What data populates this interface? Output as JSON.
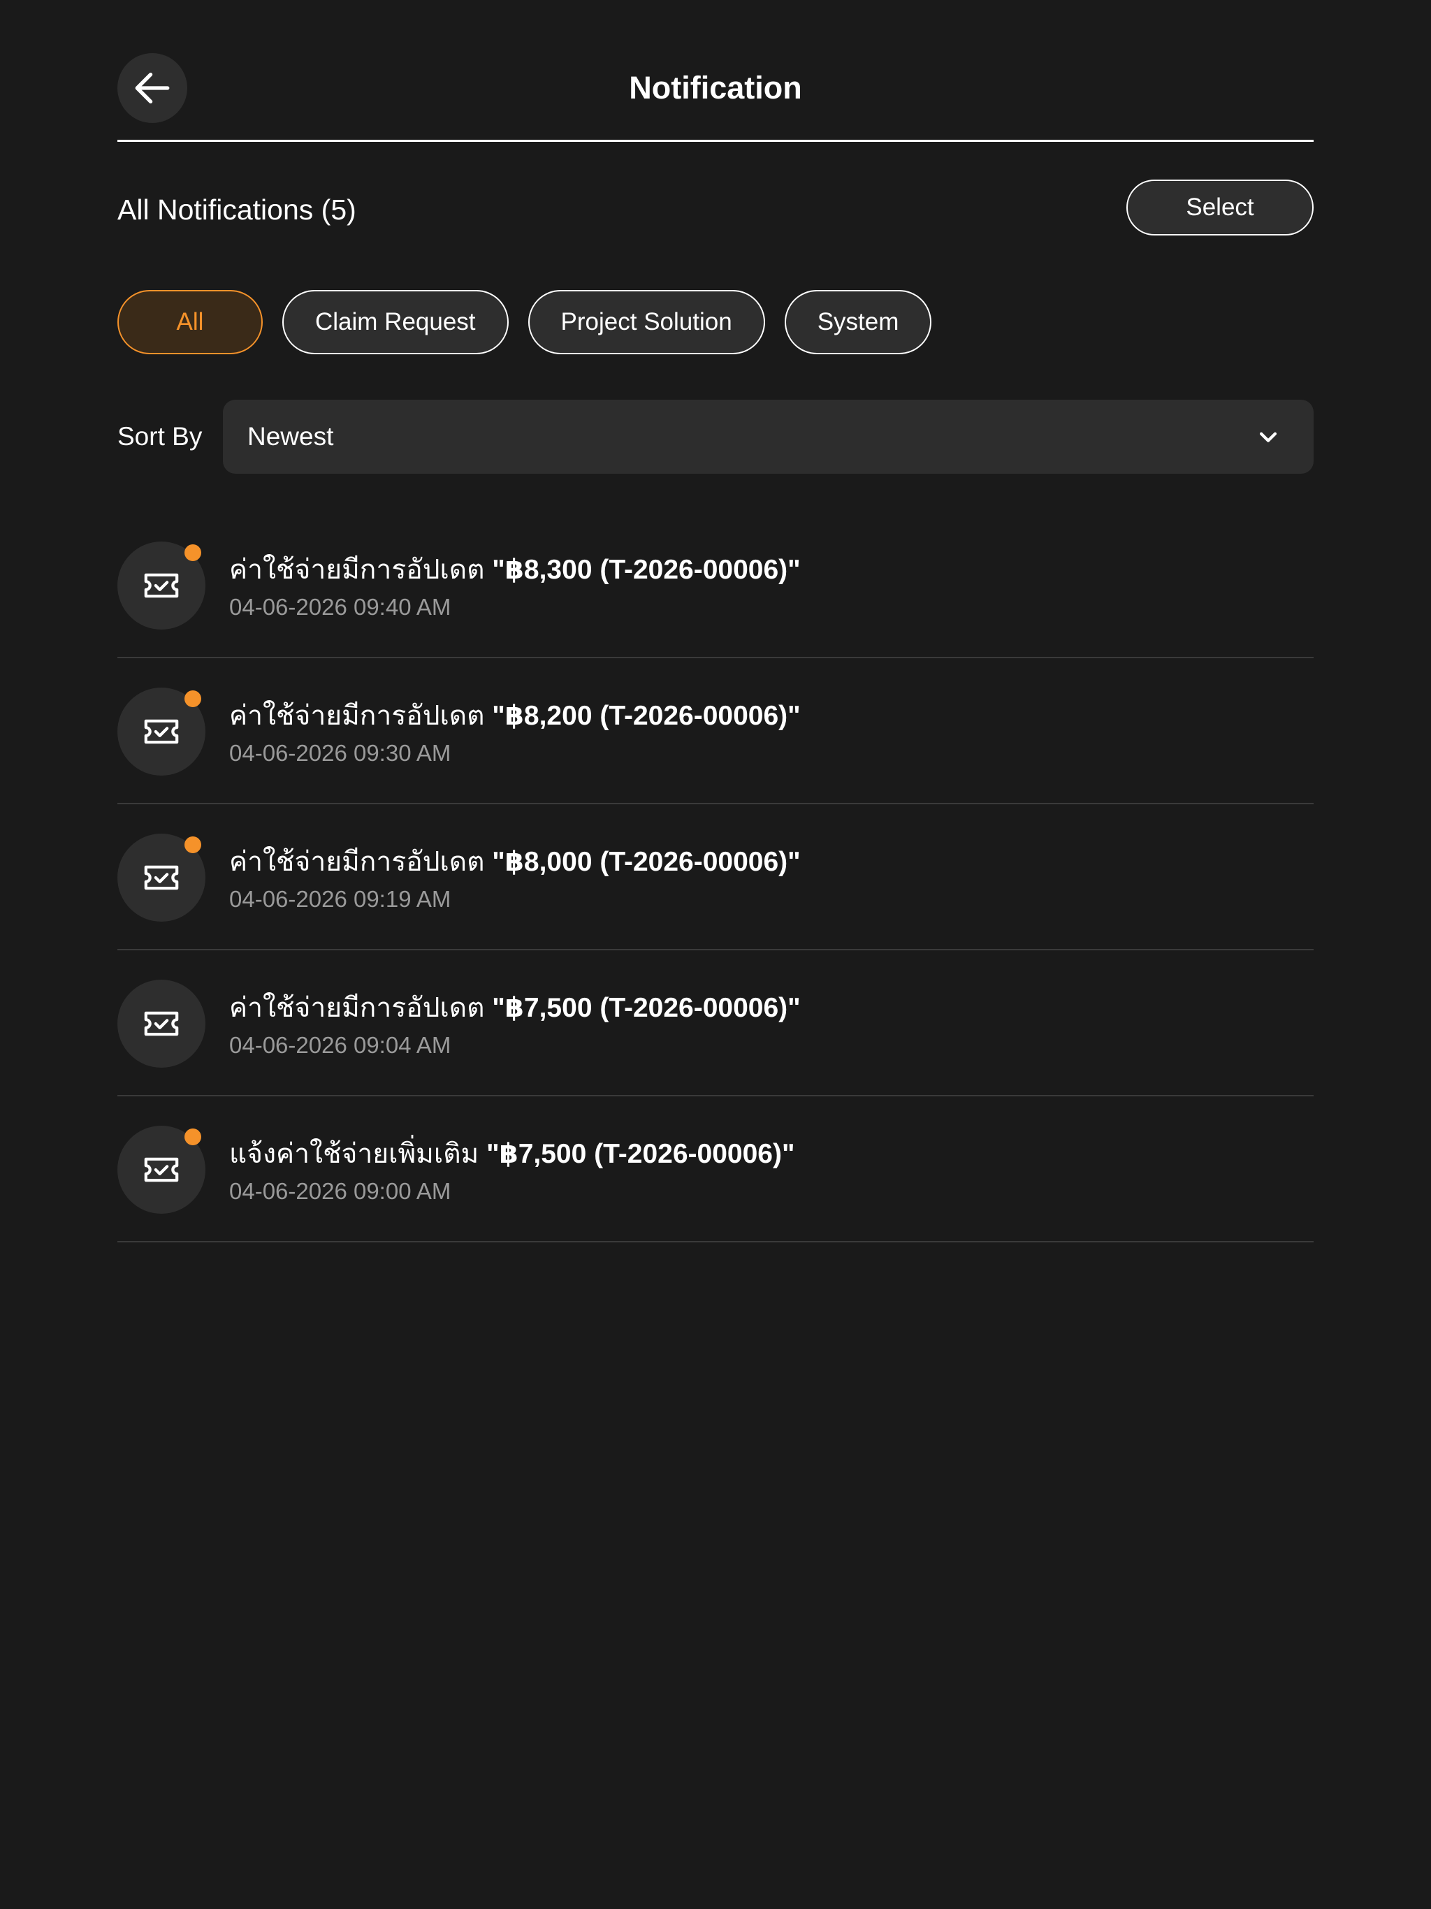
{
  "header": {
    "title": "Notification",
    "back_icon": "arrow-left-icon"
  },
  "summary": {
    "all_label": "All Notifications (5)",
    "select_label": "Select"
  },
  "filters": [
    {
      "label": "All",
      "active": true
    },
    {
      "label": "Claim Request",
      "active": false
    },
    {
      "label": "Project Solution",
      "active": false
    },
    {
      "label": "System",
      "active": false
    }
  ],
  "sort": {
    "label": "Sort By",
    "value": "Newest",
    "icon": "chevron-down-icon"
  },
  "colors": {
    "accent": "#f5922a",
    "background": "#1a1a1a",
    "surface": "#2e2e2e",
    "muted_text": "#9a9a9a"
  },
  "notifications": [
    {
      "prefix": "ค่าใช้จ่ายมีการอัปเดต ",
      "quote": "\"฿8,300 (T-2026-00006)\"",
      "time": "04-06-2026 09:40 AM",
      "unread": true,
      "icon": "ticket-check-icon"
    },
    {
      "prefix": "ค่าใช้จ่ายมีการอัปเดต ",
      "quote": "\"฿8,200 (T-2026-00006)\"",
      "time": "04-06-2026 09:30 AM",
      "unread": true,
      "icon": "ticket-check-icon"
    },
    {
      "prefix": "ค่าใช้จ่ายมีการอัปเดต ",
      "quote": "\"฿8,000 (T-2026-00006)\"",
      "time": "04-06-2026 09:19 AM",
      "unread": true,
      "icon": "ticket-check-icon"
    },
    {
      "prefix": "ค่าใช้จ่ายมีการอัปเดต ",
      "quote": "\"฿7,500 (T-2026-00006)\"",
      "time": "04-06-2026 09:04 AM",
      "unread": false,
      "icon": "ticket-check-icon"
    },
    {
      "prefix": "แจ้งค่าใช้จ่ายเพิ่มเติม ",
      "quote": "\"฿7,500 (T-2026-00006)\"",
      "time": "04-06-2026 09:00 AM",
      "unread": true,
      "icon": "ticket-check-icon"
    }
  ]
}
